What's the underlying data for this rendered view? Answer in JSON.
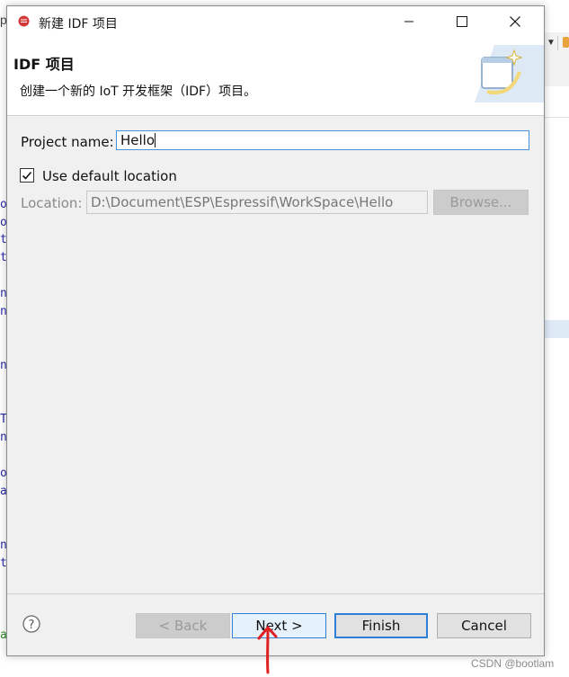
{
  "dialog": {
    "title": "新建 IDF 项目",
    "header_title": "IDF 项目",
    "header_description": "创建一个新的 IoT 开发框架（IDF）项目。"
  },
  "form": {
    "project_name_label": "Project name:",
    "project_name_value": "Hello",
    "use_default_location_label": "Use default location",
    "use_default_location_checked": true,
    "location_label": "Location:",
    "location_value": "D:\\Document\\ESP\\Espressif\\WorkSpace\\Hello",
    "browse_label": "Browse..."
  },
  "buttons": {
    "back": "< Back",
    "next": "Next >",
    "finish": "Finish",
    "cancel": "Cancel"
  },
  "watermark": "CSDN @bootlam",
  "background_fragments": [
    "o",
    "o",
    "t",
    "t",
    "n",
    "n",
    "n",
    "T",
    "n",
    "o",
    "a",
    "n",
    "t",
    "a"
  ],
  "colors": {
    "accent": "#2f7fd6",
    "annotation_arrow": "#e02020",
    "dialog_bg": "#f0f0f0"
  },
  "icons": {
    "app": "eclipse-app-icon",
    "help": "help-icon",
    "banner": "wizard-banner-icon"
  }
}
